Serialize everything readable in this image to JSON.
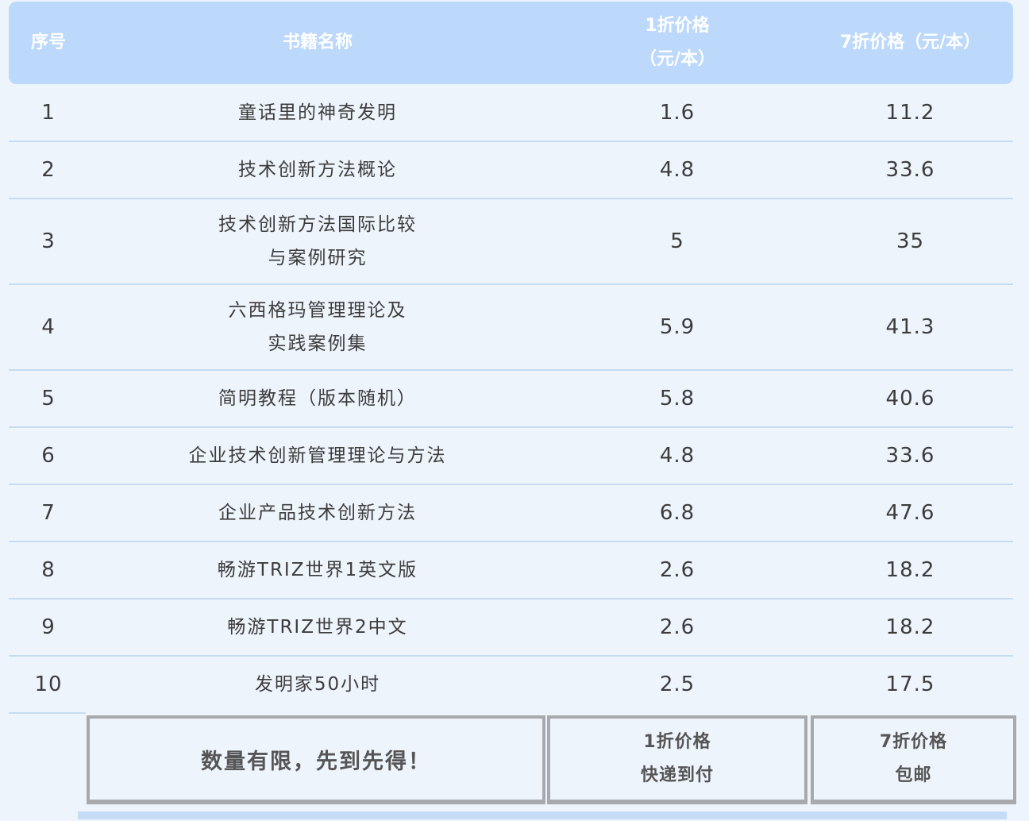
{
  "table": {
    "headers": [
      {
        "lines": [
          "序号"
        ]
      },
      {
        "lines": [
          "书籍名称"
        ]
      },
      {
        "lines": [
          "1折价格",
          "（元/本）"
        ]
      },
      {
        "lines": [
          "7折价格（元/本）"
        ]
      }
    ],
    "rows": [
      {
        "index": "1",
        "name_lines": [
          "童话里的神奇发明"
        ],
        "price_1": "1.6",
        "price_7": "11.2"
      },
      {
        "index": "2",
        "name_lines": [
          "技术创新方法概论"
        ],
        "price_1": "4.8",
        "price_7": "33.6"
      },
      {
        "index": "3",
        "name_lines": [
          "技术创新方法国际比较",
          "与案例研究"
        ],
        "price_1": "5",
        "price_7": "35"
      },
      {
        "index": "4",
        "name_lines": [
          "六西格玛管理理论及",
          "实践案例集"
        ],
        "price_1": "5.9",
        "price_7": "41.3"
      },
      {
        "index": "5",
        "name_lines": [
          "简明教程（版本随机）"
        ],
        "price_1": "5.8",
        "price_7": "40.6"
      },
      {
        "index": "6",
        "name_lines": [
          "企业技术创新管理理论与方法"
        ],
        "price_1": "4.8",
        "price_7": "33.6"
      },
      {
        "index": "7",
        "name_lines": [
          "企业产品技术创新方法"
        ],
        "price_1": "6.8",
        "price_7": "47.6"
      },
      {
        "index": "8",
        "name_lines": [
          "畅游TRIZ世界1英文版"
        ],
        "price_1": "2.6",
        "price_7": "18.2"
      },
      {
        "index": "9",
        "name_lines": [
          "畅游TRIZ世界2中文"
        ],
        "price_1": "2.6",
        "price_7": "18.2"
      },
      {
        "index": "10",
        "name_lines": [
          "发明家50小时"
        ],
        "price_1": "2.5",
        "price_7": "17.5"
      }
    ]
  },
  "footer": {
    "notice": "数量有限，先到先得！",
    "discount_1_lines": [
      "1折价格",
      "快递到付"
    ],
    "discount_7_lines": [
      "7折价格",
      "包邮"
    ]
  },
  "colors": {
    "header_bg": "#bcd8fb",
    "page_bg": "#eef4fc",
    "row_divider": "#c6dcf2",
    "footer_border": "#a7a9ad"
  }
}
